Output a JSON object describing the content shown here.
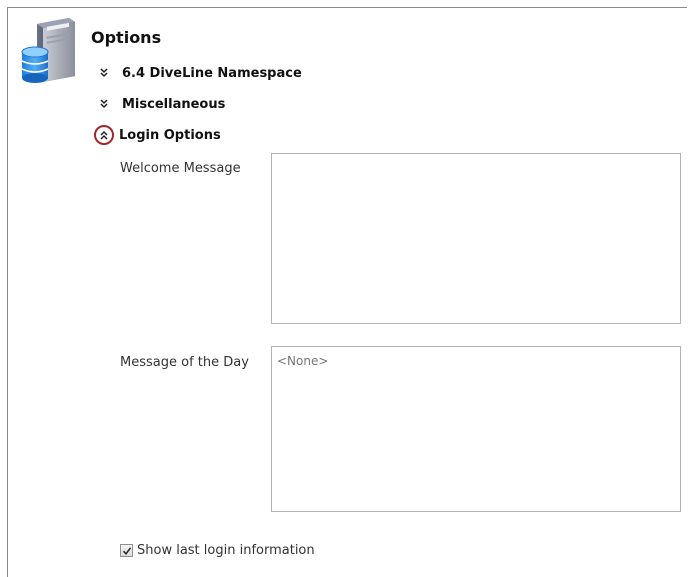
{
  "header": {
    "title": "Options",
    "icon": "database-server-icon"
  },
  "sections": [
    {
      "label": "6.4 DiveLine Namespace",
      "state": "collapsed",
      "icon": "chevron-double-down-icon"
    },
    {
      "label": "Miscellaneous",
      "state": "collapsed",
      "icon": "chevron-double-down-icon"
    },
    {
      "label": "Login Options",
      "state": "expanded",
      "icon": "chevron-double-up-icon",
      "accent": "#a3262d"
    }
  ],
  "login_options": {
    "welcome_message": {
      "label": "Welcome Message",
      "value": ""
    },
    "message_of_the_day": {
      "label": "Message of the Day",
      "placeholder": "<None>",
      "value": ""
    },
    "show_last_login": {
      "label": "Show last login information",
      "checked": true
    }
  }
}
